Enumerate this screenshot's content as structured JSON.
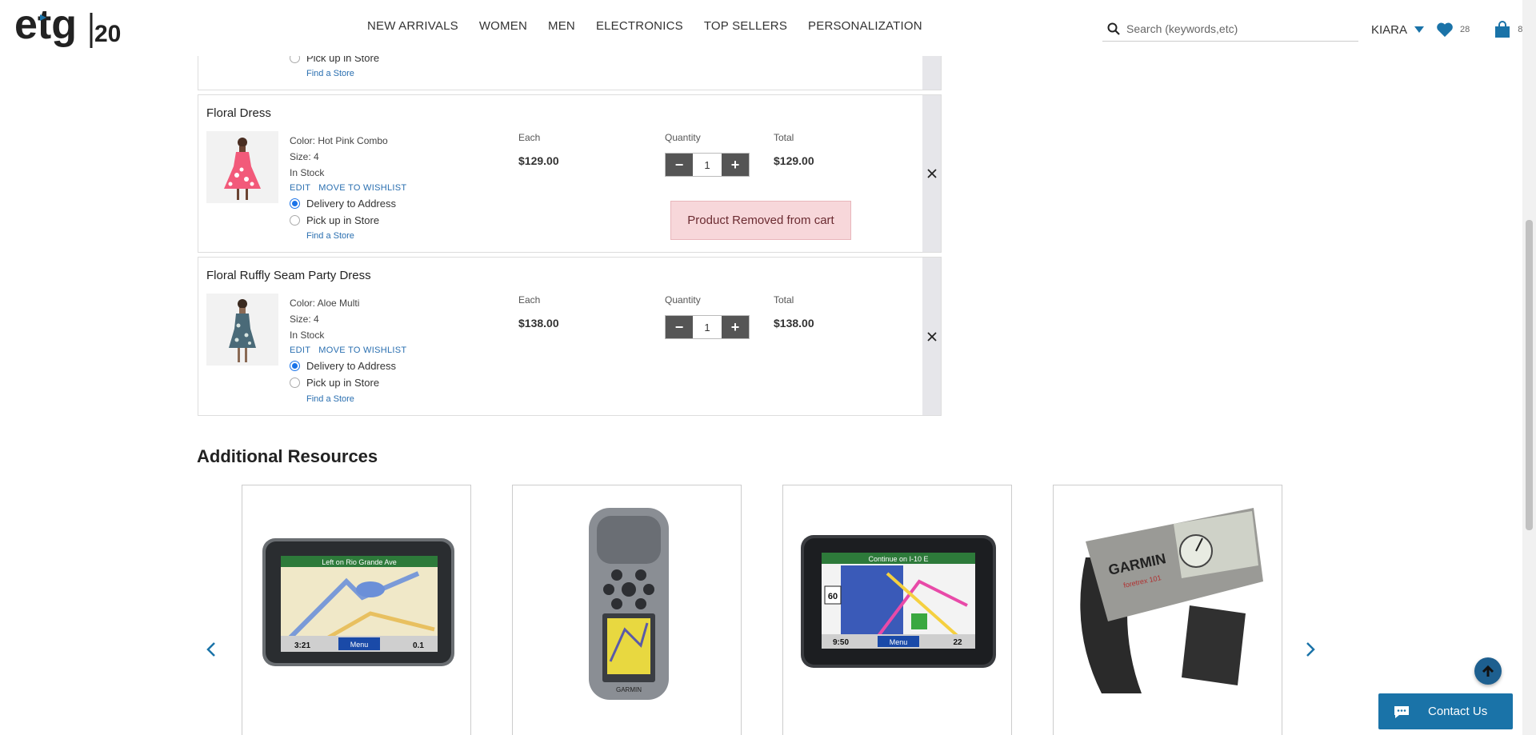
{
  "header": {
    "logo_text": "etg",
    "logo_anniversary": "20",
    "nav": [
      "NEW ARRIVALS",
      "WOMEN",
      "MEN",
      "ELECTRONICS",
      "TOP SELLERS",
      "PERSONALIZATION"
    ],
    "search_placeholder": "Search (keywords,etc)",
    "user_name": "KIARA",
    "wishlist_count": "28",
    "cart_count": "8"
  },
  "cart": {
    "previous_item": {
      "pickup_label": "Pick up in Store",
      "find_store": "Find a Store"
    },
    "items": [
      {
        "title": "Floral Dress",
        "color": "Color: Hot Pink Combo",
        "size": "Size: 4",
        "stock": "In Stock",
        "edit": "EDIT",
        "wishlist": "MOVE TO WISHLIST",
        "delivery_label": "Delivery to Address",
        "pickup_label": "Pick up in Store",
        "find_store": "Find a Store",
        "each_label": "Each",
        "each_price": "$129.00",
        "qty_label": "Quantity",
        "qty": "1",
        "total_label": "Total",
        "total": "$129.00",
        "delivery_selected": true
      },
      {
        "title": "Floral Ruffly Seam Party Dress",
        "color": "Color: Aloe Multi",
        "size": "Size: 4",
        "stock": "In Stock",
        "edit": "EDIT",
        "wishlist": "MOVE TO WISHLIST",
        "delivery_label": "Delivery to Address",
        "pickup_label": "Pick up in Store",
        "find_store": "Find a Store",
        "each_label": "Each",
        "each_price": "$138.00",
        "qty_label": "Quantity",
        "qty": "1",
        "total_label": "Total",
        "total": "$138.00",
        "delivery_selected": true
      }
    ],
    "toast": "Product Removed from cart"
  },
  "resources": {
    "title": "Additional Resources",
    "products": [
      {
        "screen_label": "Left on Rio Grande Ave",
        "readout_left": "3:21",
        "readout_mid": "Menu",
        "readout_right": "0.1"
      },
      {
        "brand": "GARMIN"
      },
      {
        "screen_label": "Continue on I-10 E",
        "readout_left": "9:50",
        "readout_mid": "Menu",
        "readout_right": "22",
        "speed": "60"
      },
      {
        "brand": "GARMIN",
        "model": "foretrex 101"
      }
    ]
  },
  "chat": {
    "contact_label": "Contact Us"
  },
  "colors": {
    "accent": "#1a73a8",
    "link": "#2a6fb0",
    "toast_bg": "#f7d7da"
  }
}
